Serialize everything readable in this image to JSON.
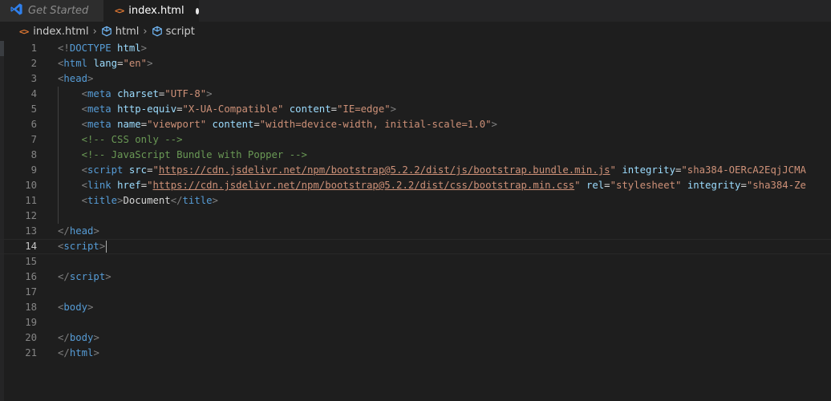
{
  "tabs": [
    {
      "label": "Get Started",
      "icon": "vscode-logo-icon",
      "active": false
    },
    {
      "label": "index.html",
      "icon": "html-file-icon",
      "active": true,
      "dirty": true
    }
  ],
  "breadcrumb": [
    {
      "label": "index.html",
      "icon": "html-file-icon"
    },
    {
      "label": "html",
      "icon": "symbol-element-icon"
    },
    {
      "label": "script",
      "icon": "symbol-element-icon"
    }
  ],
  "editor": {
    "current_line": 14,
    "lines": [
      {
        "n": "1",
        "tokens": [
          [
            "bracket",
            "<!"
          ],
          [
            "tag",
            "DOCTYPE"
          ],
          [
            "text",
            " "
          ],
          [
            "attr",
            "html"
          ],
          [
            "bracket",
            ">"
          ]
        ]
      },
      {
        "n": "2",
        "tokens": [
          [
            "bracket",
            "<"
          ],
          [
            "tag",
            "html"
          ],
          [
            "text",
            " "
          ],
          [
            "attr",
            "lang"
          ],
          [
            "text",
            "="
          ],
          [
            "str",
            "\"en\""
          ],
          [
            "bracket",
            ">"
          ]
        ]
      },
      {
        "n": "3",
        "tokens": [
          [
            "bracket",
            "<"
          ],
          [
            "tag",
            "head"
          ],
          [
            "bracket",
            ">"
          ]
        ]
      },
      {
        "n": "4",
        "tokens": [
          [
            "text",
            "    "
          ],
          [
            "bracket",
            "<"
          ],
          [
            "tag",
            "meta"
          ],
          [
            "text",
            " "
          ],
          [
            "attr",
            "charset"
          ],
          [
            "text",
            "="
          ],
          [
            "str",
            "\"UTF-8\""
          ],
          [
            "bracket",
            ">"
          ]
        ]
      },
      {
        "n": "5",
        "tokens": [
          [
            "text",
            "    "
          ],
          [
            "bracket",
            "<"
          ],
          [
            "tag",
            "meta"
          ],
          [
            "text",
            " "
          ],
          [
            "attr",
            "http-equiv"
          ],
          [
            "text",
            "="
          ],
          [
            "str",
            "\"X-UA-Compatible\""
          ],
          [
            "text",
            " "
          ],
          [
            "attr",
            "content"
          ],
          [
            "text",
            "="
          ],
          [
            "str",
            "\"IE=edge\""
          ],
          [
            "bracket",
            ">"
          ]
        ]
      },
      {
        "n": "6",
        "tokens": [
          [
            "text",
            "    "
          ],
          [
            "bracket",
            "<"
          ],
          [
            "tag",
            "meta"
          ],
          [
            "text",
            " "
          ],
          [
            "attr",
            "name"
          ],
          [
            "text",
            "="
          ],
          [
            "str",
            "\"viewport\""
          ],
          [
            "text",
            " "
          ],
          [
            "attr",
            "content"
          ],
          [
            "text",
            "="
          ],
          [
            "str",
            "\"width=device-width, initial-scale=1.0\""
          ],
          [
            "bracket",
            ">"
          ]
        ]
      },
      {
        "n": "7",
        "tokens": [
          [
            "text",
            "    "
          ],
          [
            "comment",
            "<!-- CSS only -->"
          ]
        ]
      },
      {
        "n": "8",
        "tokens": [
          [
            "text",
            "    "
          ],
          [
            "comment",
            "<!-- JavaScript Bundle with Popper -->"
          ]
        ]
      },
      {
        "n": "9",
        "tokens": [
          [
            "text",
            "    "
          ],
          [
            "bracket",
            "<"
          ],
          [
            "tag",
            "script"
          ],
          [
            "text",
            " "
          ],
          [
            "attr",
            "src"
          ],
          [
            "text",
            "="
          ],
          [
            "str",
            "\""
          ],
          [
            "str-u",
            "https://cdn.jsdelivr.net/npm/bootstrap@5.2.2/dist/js/bootstrap.bundle.min.js"
          ],
          [
            "str",
            "\""
          ],
          [
            "text",
            " "
          ],
          [
            "attr",
            "integrity"
          ],
          [
            "text",
            "="
          ],
          [
            "str",
            "\"sha384-OERcA2EqjJCMA"
          ]
        ]
      },
      {
        "n": "10",
        "tokens": [
          [
            "text",
            "    "
          ],
          [
            "bracket",
            "<"
          ],
          [
            "tag",
            "link"
          ],
          [
            "text",
            " "
          ],
          [
            "attr",
            "href"
          ],
          [
            "text",
            "="
          ],
          [
            "str",
            "\""
          ],
          [
            "str-u",
            "https://cdn.jsdelivr.net/npm/bootstrap@5.2.2/dist/css/bootstrap.min.css"
          ],
          [
            "str",
            "\""
          ],
          [
            "text",
            " "
          ],
          [
            "attr",
            "rel"
          ],
          [
            "text",
            "="
          ],
          [
            "str",
            "\"stylesheet\""
          ],
          [
            "text",
            " "
          ],
          [
            "attr",
            "integrity"
          ],
          [
            "text",
            "="
          ],
          [
            "str",
            "\"sha384-Ze"
          ]
        ]
      },
      {
        "n": "11",
        "tokens": [
          [
            "text",
            "    "
          ],
          [
            "bracket",
            "<"
          ],
          [
            "tag",
            "title"
          ],
          [
            "bracket",
            ">"
          ],
          [
            "text",
            "Document"
          ],
          [
            "bracket",
            "</"
          ],
          [
            "tag",
            "title"
          ],
          [
            "bracket",
            ">"
          ]
        ]
      },
      {
        "n": "12",
        "tokens": []
      },
      {
        "n": "13",
        "tokens": [
          [
            "bracket",
            "</"
          ],
          [
            "tag",
            "head"
          ],
          [
            "bracket",
            ">"
          ]
        ]
      },
      {
        "n": "14",
        "tokens": [
          [
            "bracket",
            "<"
          ],
          [
            "tag",
            "script"
          ],
          [
            "bracket",
            ">"
          ]
        ]
      },
      {
        "n": "15",
        "tokens": []
      },
      {
        "n": "16",
        "tokens": [
          [
            "bracket",
            "</"
          ],
          [
            "tag",
            "script"
          ],
          [
            "bracket",
            ">"
          ]
        ]
      },
      {
        "n": "17",
        "tokens": []
      },
      {
        "n": "18",
        "tokens": [
          [
            "bracket",
            "<"
          ],
          [
            "tag",
            "body"
          ],
          [
            "bracket",
            ">"
          ]
        ]
      },
      {
        "n": "19",
        "tokens": []
      },
      {
        "n": "20",
        "tokens": [
          [
            "bracket",
            "</"
          ],
          [
            "tag",
            "body"
          ],
          [
            "bracket",
            ">"
          ]
        ]
      },
      {
        "n": "21",
        "tokens": [
          [
            "bracket",
            "</"
          ],
          [
            "tag",
            "html"
          ],
          [
            "bracket",
            ">"
          ]
        ]
      }
    ]
  },
  "colors": {
    "bracket": "#808080",
    "tag": "#569cd6",
    "attr": "#9cdcfe",
    "string": "#ce9178",
    "text": "#d4d4d4",
    "comment": "#6a9955",
    "vscode_blue": "#2f80ed",
    "html_orange": "#e37933"
  }
}
